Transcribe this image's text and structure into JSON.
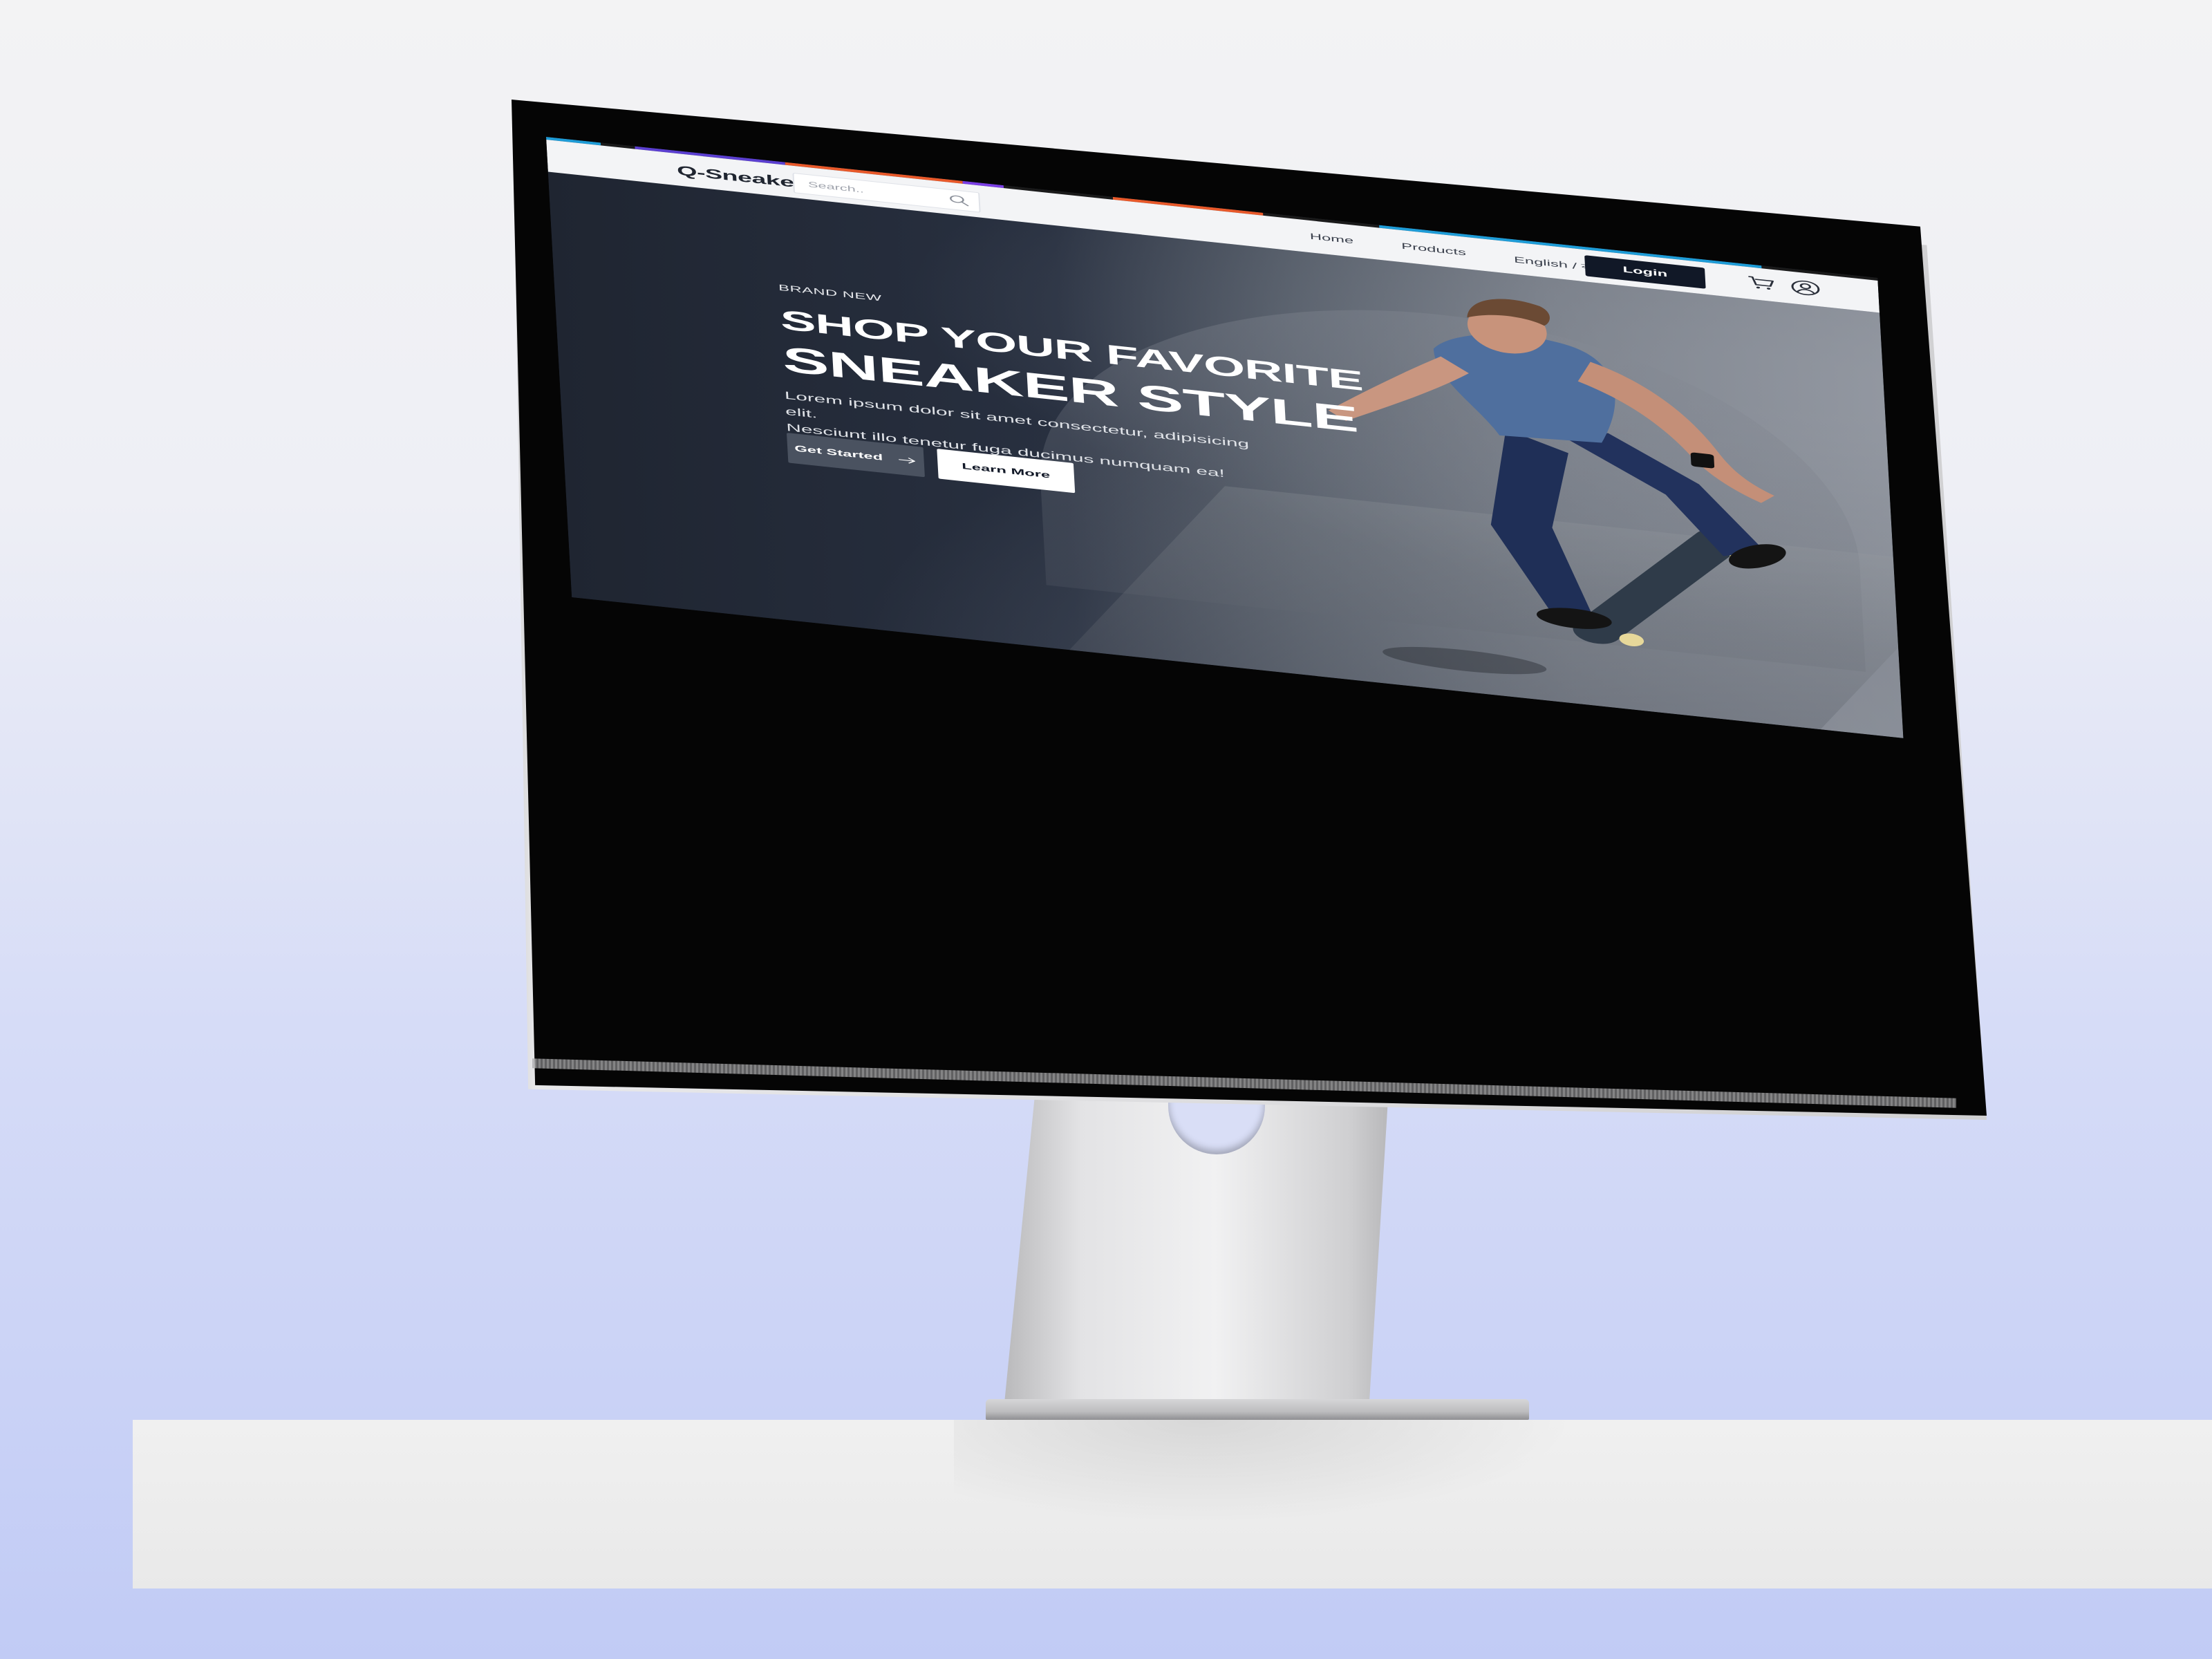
{
  "brand": {
    "name": "Q-Sneakers"
  },
  "search": {
    "placeholder": "Search.."
  },
  "nav": {
    "items": [
      {
        "label": "Home"
      },
      {
        "label": "Products"
      },
      {
        "label": "English / বাংলা"
      }
    ],
    "login_label": "Login"
  },
  "hero": {
    "eyebrow": "BRAND NEW",
    "headline_line1": "SHOP YOUR FAVORITE",
    "headline_line2": "SNEAKER STYLE",
    "body_line1": "Lorem ipsum dolor sit amet consectetur, adipisicing elit.",
    "body_line2": "Nesciunt illo tenetur fuga ducimus numquam ea!",
    "primary_cta": "Get Started",
    "secondary_cta": "Learn More"
  },
  "colors": {
    "nav_background": "#f3f4f6",
    "login_button": "#111827",
    "hero_dark": "#1f2531",
    "primary_button": "#4a5260",
    "stripe_colors": [
      "#1e9cd7",
      "#5b3fd1",
      "#e8592a",
      "#7b3fe4",
      "#1e9cd7"
    ]
  },
  "icons": {
    "search": "search-icon",
    "cart": "cart-icon",
    "user": "user-icon",
    "arrow": "arrow-right-icon"
  }
}
